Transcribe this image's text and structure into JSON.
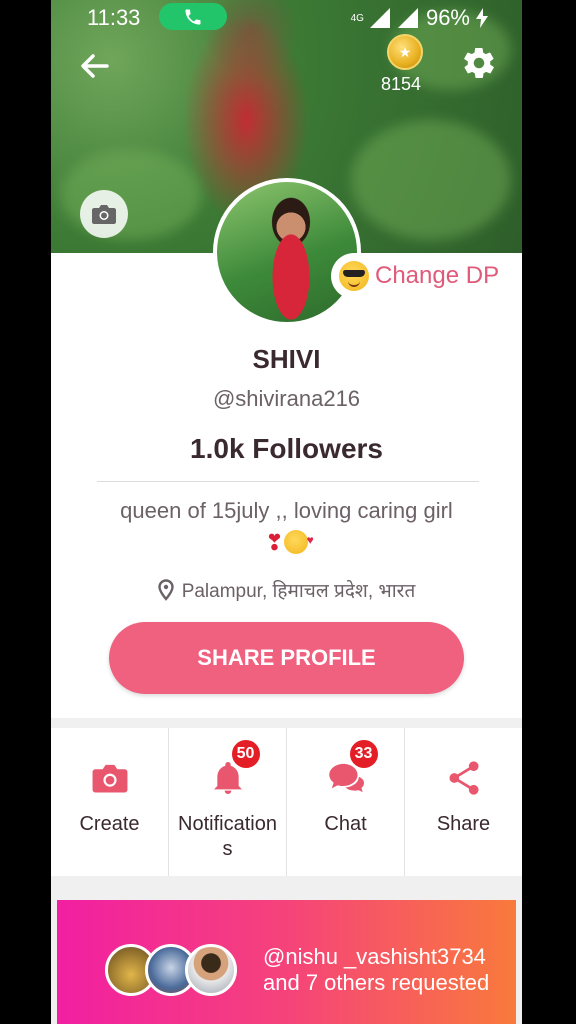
{
  "status_bar": {
    "time": "11:33",
    "network": "4G",
    "battery": "96%"
  },
  "header": {
    "coins": "8154",
    "change_dp_label": "Change DP"
  },
  "profile": {
    "name": "SHIVI",
    "handle": "@shivirana216",
    "followers": "1.0k Followers",
    "bio": "queen of 15july ,, loving caring girl",
    "location": "Palampur, हिमाचल प्रदेश, भारत",
    "share_button": "SHARE PROFILE"
  },
  "actions": [
    {
      "label": "Create",
      "icon": "camera-icon",
      "badge": ""
    },
    {
      "label": "Notifications",
      "icon": "bell-icon",
      "badge": "50"
    },
    {
      "label": "Chat",
      "icon": "chat-icon",
      "badge": "33"
    },
    {
      "label": "Share",
      "icon": "share-icon",
      "badge": ""
    }
  ],
  "requests": {
    "text": "@nishu _vashisht3734 and 7 others requested"
  },
  "colors": {
    "accent": "#f0607f",
    "badge": "#e41e26",
    "banner_start": "#f21fa2",
    "banner_end": "#f97a3c"
  }
}
